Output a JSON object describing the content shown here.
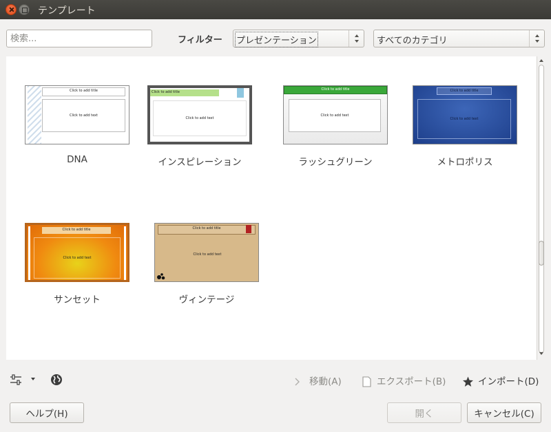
{
  "window": {
    "title": "テンプレート"
  },
  "toolbar": {
    "search_placeholder": "検索...",
    "filter_label": "フィルター",
    "filter_value": "プレゼンテーション",
    "category_value": "すべてのカテゴリ"
  },
  "templates": [
    {
      "name": "DNA",
      "title_placeholder": "Click to add title",
      "text_placeholder": "Click to add text"
    },
    {
      "name": "インスピレーション",
      "title_placeholder": "Click to add title",
      "text_placeholder": "Click to add text"
    },
    {
      "name": "ラッシュグリーン",
      "title_placeholder": "Click to add title",
      "text_placeholder": "Click to add text"
    },
    {
      "name": "メトロポリス",
      "title_placeholder": "Click to add title",
      "text_placeholder": "Click to add text"
    },
    {
      "name": "サンセット",
      "title_placeholder": "Click to add title",
      "text_placeholder": "Click to add text"
    },
    {
      "name": "ヴィンテージ",
      "title_placeholder": "Click to add title",
      "text_placeholder": "Click to add text"
    }
  ],
  "actions": {
    "move": "移動(A)",
    "export": "エクスポート(B)",
    "import": "インポート(D)"
  },
  "buttons": {
    "help": "ヘルプ(H)",
    "open": "開く",
    "cancel": "キャンセル(C)"
  },
  "icons": [
    "close-icon",
    "maximize-icon",
    "settings-sliders-icon",
    "dropdown-caret-icon",
    "globe-icon",
    "chevron-right-icon",
    "document-icon",
    "star-icon"
  ],
  "colors": {
    "titlebar": "#3b3a36",
    "close_button": "#df4a16",
    "dialog_bg": "#f2f1f0"
  }
}
